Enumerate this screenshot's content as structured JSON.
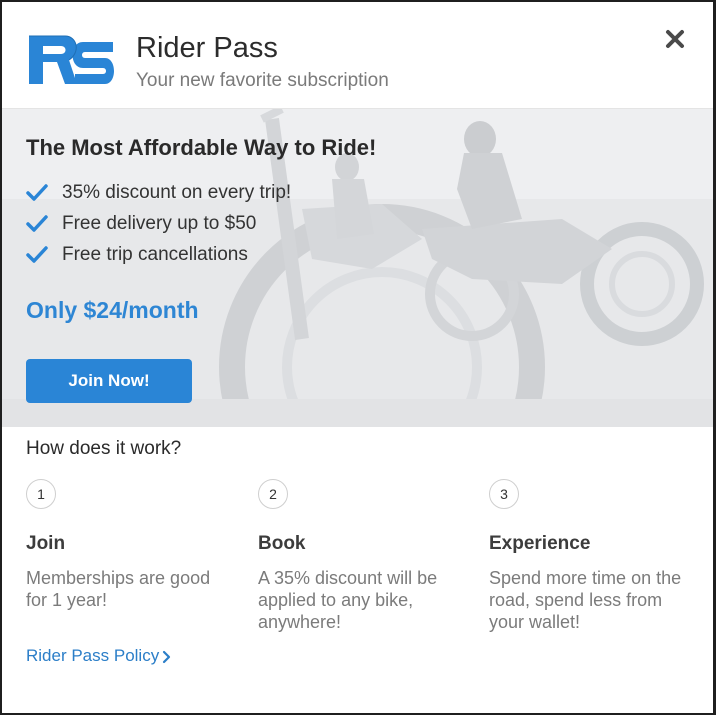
{
  "header": {
    "title": "Rider Pass",
    "subtitle": "Your new favorite subscription",
    "logo_icon": "rider-pass-logo",
    "close_icon": "close-icon"
  },
  "hero": {
    "title": "The Most Affordable Way to Ride!",
    "benefits": [
      "35% discount on every trip!",
      "Free delivery up to $50",
      "Free trip cancellations"
    ],
    "price": "Only $24/month",
    "cta_label": "Join Now!"
  },
  "how": {
    "title": "How does it work?",
    "steps": [
      {
        "number": "1",
        "name": "Join",
        "description": "Memberships are good for 1 year!"
      },
      {
        "number": "2",
        "name": "Book",
        "description": "A 35% discount will be applied to any bike, anywhere!"
      },
      {
        "number": "3",
        "name": "Experience",
        "description": "Spend more time on the road, spend less from your wallet!"
      }
    ]
  },
  "footer": {
    "policy_link": "Rider Pass Policy"
  },
  "colors": {
    "accent": "#2a85d6",
    "brand_blue": "#2e86d4",
    "hero_bg": "#e9eaec"
  }
}
